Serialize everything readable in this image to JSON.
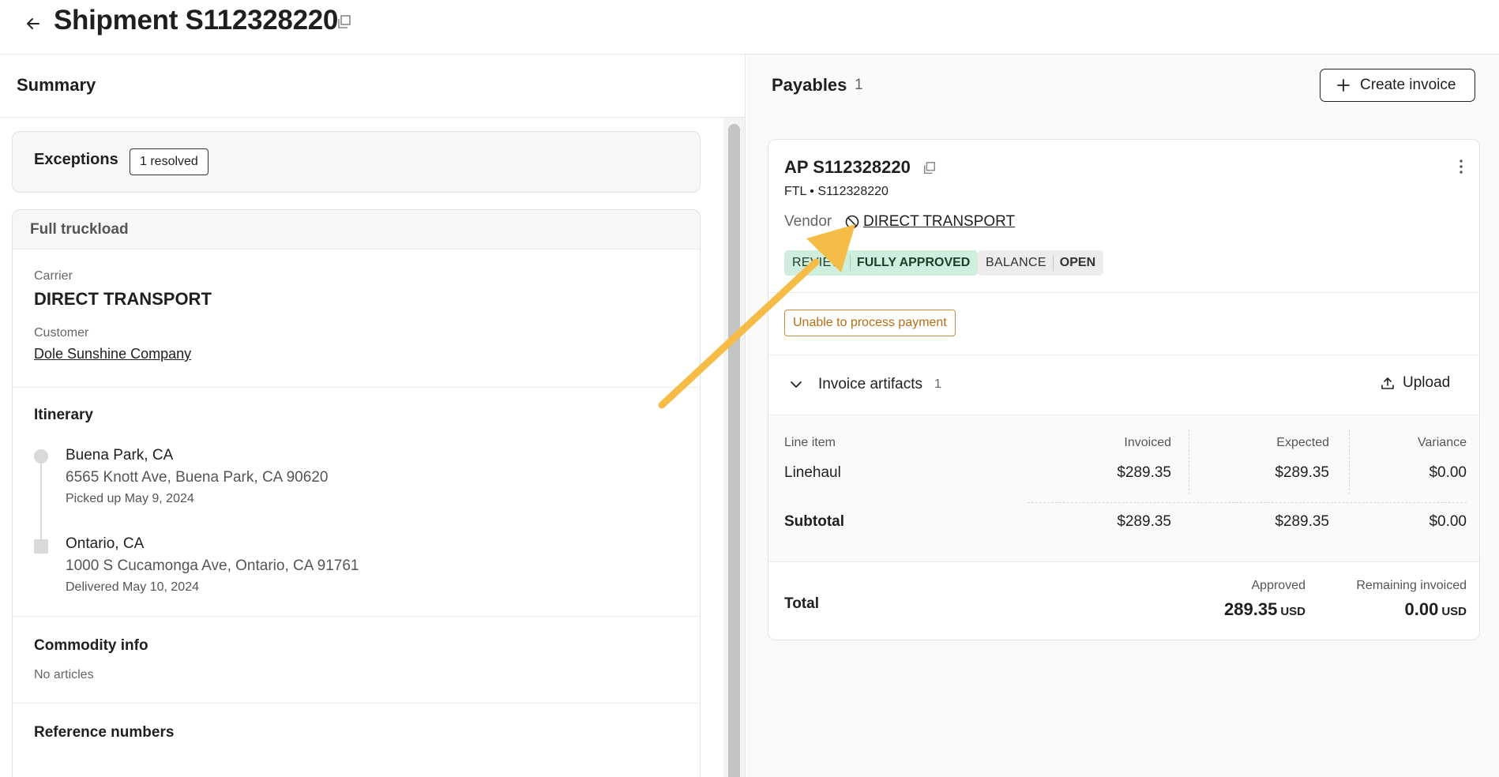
{
  "header": {
    "title": "Shipment S112328220"
  },
  "summary": {
    "title": "Summary",
    "exceptions": {
      "label": "Exceptions",
      "badge": "1 resolved"
    },
    "mode": "Full truckload",
    "carrier": {
      "label": "Carrier",
      "value": "DIRECT TRANSPORT"
    },
    "customer": {
      "label": "Customer",
      "value": "Dole Sunshine Company"
    },
    "itinerary": {
      "title": "Itinerary",
      "stops": [
        {
          "city": "Buena Park, CA",
          "address": "6565 Knott Ave, Buena Park, CA 90620",
          "event": "Picked up May 9, 2024"
        },
        {
          "city": "Ontario, CA",
          "address": "1000 S Cucamonga Ave, Ontario, CA 91761",
          "event": "Delivered May 10, 2024"
        }
      ]
    },
    "commodity": {
      "title": "Commodity info",
      "value": "No articles"
    },
    "references": {
      "title": "Reference numbers"
    }
  },
  "payables": {
    "title": "Payables",
    "count": "1",
    "create_label": "Create invoice",
    "card": {
      "title": "AP S112328220",
      "subtitle": "FTL • S112328220",
      "vendor_label": "Vendor",
      "vendor_name": "DIRECT TRANSPORT",
      "review": {
        "key": "REVIEW",
        "value": "FULLY APPROVED"
      },
      "balance": {
        "key": "BALANCE",
        "value": "OPEN"
      },
      "warning": "Unable to process payment",
      "artifacts": {
        "label": "Invoice artifacts",
        "count": "1",
        "upload_label": "Upload"
      },
      "table": {
        "headers": [
          "Line item",
          "Invoiced",
          "Expected",
          "Variance"
        ],
        "rows": [
          {
            "item": "Linehaul",
            "invoiced": "$289.35",
            "expected": "$289.35",
            "variance": "$0.00"
          }
        ],
        "subtotal": {
          "label": "Subtotal",
          "invoiced": "$289.35",
          "expected": "$289.35",
          "variance": "$0.00"
        }
      },
      "total": {
        "label": "Total",
        "approved_label": "Approved",
        "approved_value": "289.35",
        "remaining_label": "Remaining invoiced",
        "remaining_value": "0.00",
        "currency": "USD"
      }
    }
  },
  "colors": {
    "arrow": "#f5bd47",
    "review_chip": "#cfeedd",
    "warning": "#b76d14"
  }
}
